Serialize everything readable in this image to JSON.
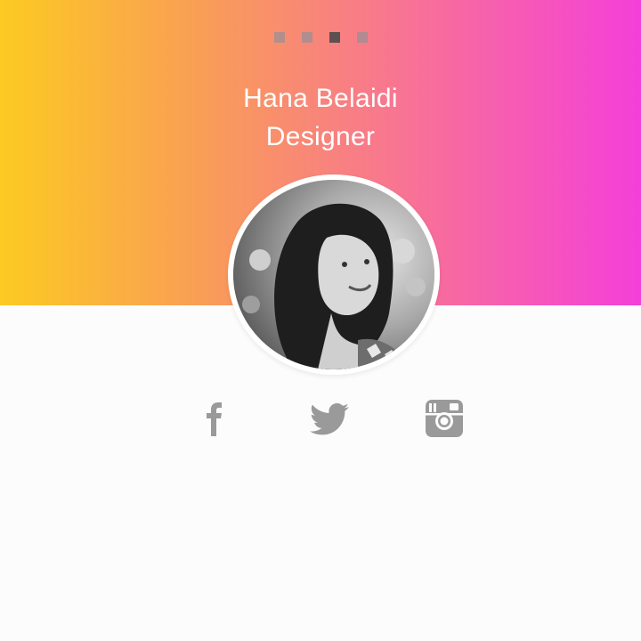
{
  "pagination": {
    "slides": [
      {
        "label": "slide 1",
        "active": false
      },
      {
        "label": "slide 2",
        "active": false
      },
      {
        "label": "slide 3",
        "active": true
      },
      {
        "label": "slide 4",
        "active": false
      }
    ]
  },
  "profile": {
    "name": "Hana Belaidi",
    "role": "Designer"
  },
  "social": {
    "icons": [
      "facebook-icon",
      "twitter-icon",
      "instagram-icon"
    ]
  },
  "colors": {
    "gradient_start": "#fcca22",
    "gradient_end": "#f43fd9",
    "icon_gray": "#9a9a9a",
    "background": "#fcfcfc"
  }
}
